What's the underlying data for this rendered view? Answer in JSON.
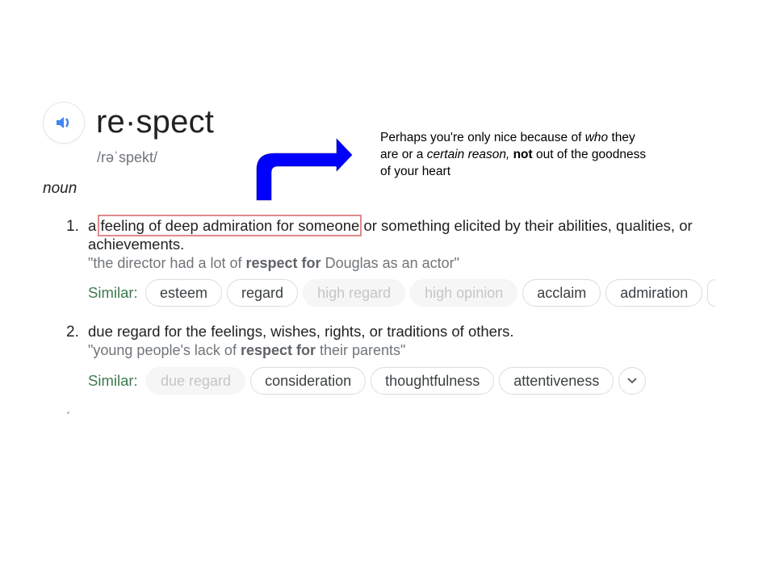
{
  "entry": {
    "headword": "re·spect",
    "phonetic": "/rəˈspekt/",
    "part_of_speech": "noun",
    "audio_icon": "speaker-icon",
    "accent_color": "#4285f4"
  },
  "senses": [
    {
      "number": "1.",
      "definition_prefix": "a ",
      "definition_highlight": "feeling of deep admiration for someone",
      "definition_rest": " or something elicited by their abilities, qualities, or achievements.",
      "example_open": "\"the director had a lot of ",
      "example_bold": "respect for",
      "example_close": " Douglas as an actor\"",
      "similar_label": "Similar:",
      "similar": [
        {
          "label": "esteem",
          "muted": false
        },
        {
          "label": "regard",
          "muted": false
        },
        {
          "label": "high regard",
          "muted": true
        },
        {
          "label": "high opinion",
          "muted": true
        },
        {
          "label": "acclaim",
          "muted": false
        },
        {
          "label": "admiration",
          "muted": false
        }
      ]
    },
    {
      "number": "2.",
      "definition": "due regard for the feelings, wishes, rights, or traditions of others.",
      "example_open": "\"young people's lack of ",
      "example_bold": "respect for",
      "example_close": " their parents\"",
      "similar_label": "Similar:",
      "similar": [
        {
          "label": "due regard",
          "muted": true
        },
        {
          "label": "consideration",
          "muted": false
        },
        {
          "label": "thoughtfulness",
          "muted": false
        },
        {
          "label": "attentiveness",
          "muted": false
        }
      ],
      "expand_icon": "chevron-down-icon"
    }
  ],
  "annotation": {
    "arrow_color": "#0000ff",
    "text_part1": "Perhaps you're only nice because of ",
    "text_italic1": "who",
    "text_part2": " they are or a ",
    "text_italic2": "certain reason,",
    "text_part3": " ",
    "text_bold": "not",
    "text_part4": " out of the goodness of your heart"
  }
}
